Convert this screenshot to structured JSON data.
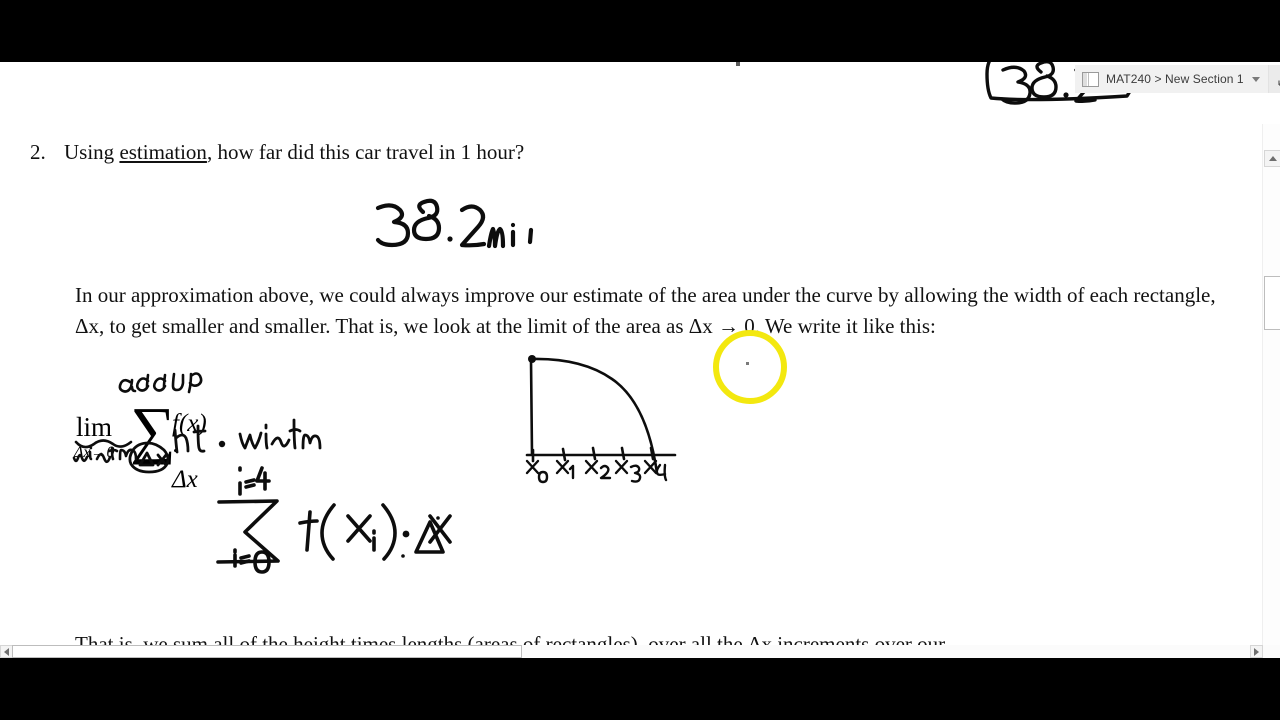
{
  "app": {
    "tab": {
      "label": "MAT240 > New Section 1",
      "page_icon": "page-icon",
      "dropdown_icon": "chevron-down-icon",
      "expand_icon": "expand-arrow-icon"
    }
  },
  "document": {
    "question": {
      "number": "2.",
      "text_before": "Using ",
      "underlined_word": "estimation",
      "text_after": ", how far did this car travel in 1 hour?"
    },
    "paragraph": "In our approximation above, we could always improve our estimate of the area under the curve by allowing the width of each rectangle, Δx, to get smaller and smaller. That is, we look at the limit of the area as Δx → 0. We write it like this:",
    "formula": {
      "lim": "lim",
      "lim_subscript": "Δx→0",
      "sigma": "∑",
      "body": "f(x) · Δx"
    },
    "clipped_line": "That is, we sum all of the height times lengths (areas of rectangles), over all the Δx increments over our"
  },
  "annotations": {
    "answer_ink": "38.2 mi",
    "answer_ink_tab": "38.2",
    "add_up": "add up",
    "width_label": "width",
    "delta_x_boxed": "Δx",
    "ht_width": "ht · width",
    "hand_sum": {
      "upper_limit": "i=4",
      "sigma": "∑",
      "lower_limit": "i=0",
      "body": "f(xᵢ) · Δx"
    },
    "graph_tick_labels": [
      "x₀",
      "x₁",
      "x₂",
      "x₃",
      "x₄"
    ],
    "highlight_color": "#f3e80f",
    "ink_color": "#0d0d0d"
  },
  "scrollbars": {
    "vertical": {
      "up": "scroll-up-arrow",
      "down": "scroll-down-arrow",
      "thumb": "vertical-thumb"
    },
    "horizontal": {
      "left": "scroll-left-arrow",
      "right": "scroll-right-arrow",
      "thumb": "horizontal-thumb"
    }
  }
}
